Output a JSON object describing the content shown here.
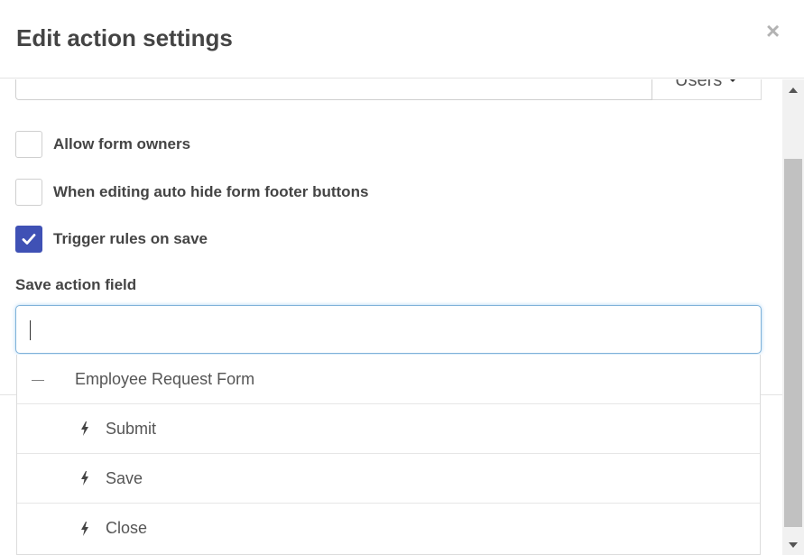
{
  "modal": {
    "title": "Edit action settings",
    "close_symbol": "×"
  },
  "users_field": {
    "value": "",
    "button_label": "Users"
  },
  "options": [
    {
      "label": "Allow form owners",
      "checked": false
    },
    {
      "label": "When editing auto hide form footer buttons",
      "checked": false
    },
    {
      "label": "Trigger rules on save",
      "checked": true
    }
  ],
  "save_action_field": {
    "label": "Save action field",
    "value": ""
  },
  "dropdown": {
    "group": {
      "label": "Employee Request Form",
      "icon": "minus-icon"
    },
    "items": [
      {
        "label": "Submit",
        "icon": "bolt-icon"
      },
      {
        "label": "Save",
        "icon": "bolt-icon"
      },
      {
        "label": "Close",
        "icon": "bolt-icon"
      }
    ]
  },
  "colors": {
    "accent": "#3f51b5",
    "focus_border": "#7fb2d9",
    "title_text": "#444444"
  }
}
